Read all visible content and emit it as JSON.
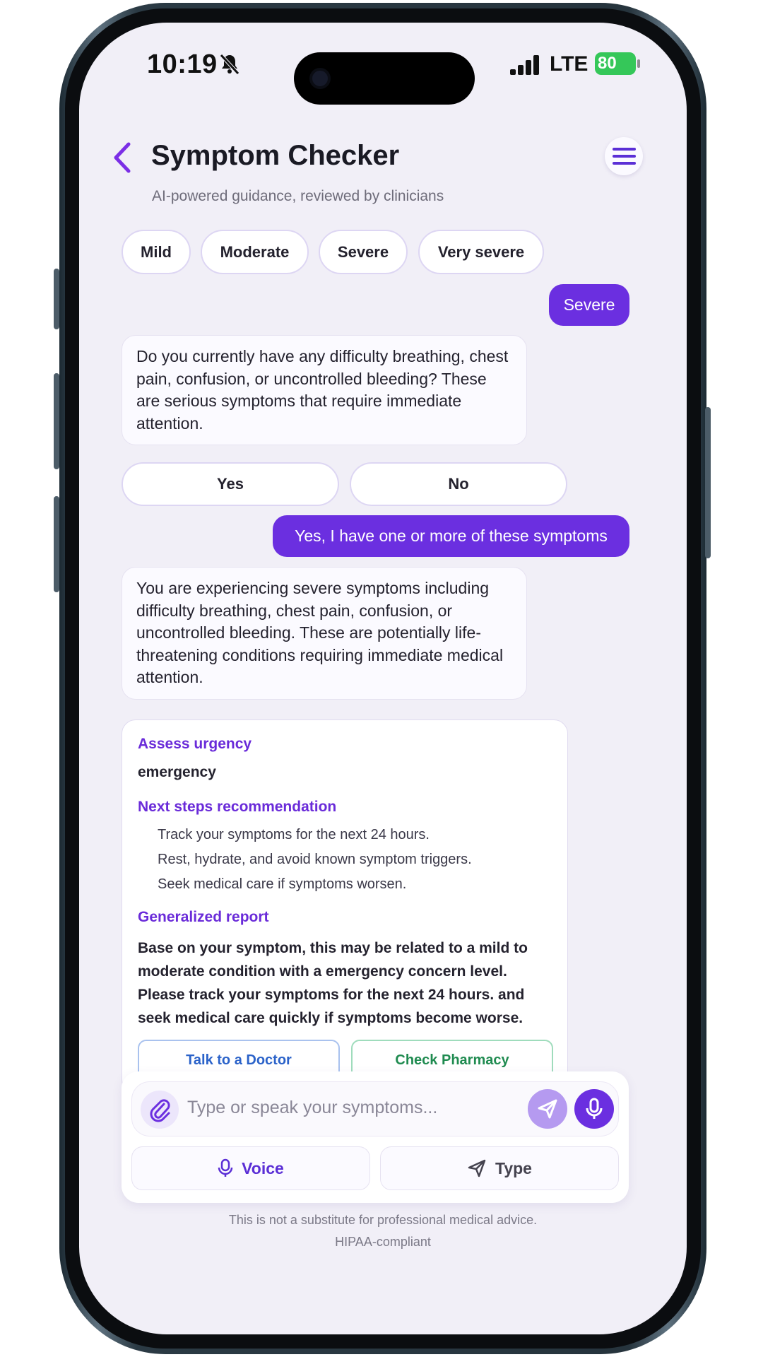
{
  "status": {
    "time": "10:19",
    "network": "LTE",
    "battery": "80"
  },
  "header": {
    "title": "Symptom Checker",
    "subtitle": "AI-powered guidance, reviewed by clinicians"
  },
  "severity_options": [
    "Mild",
    "Moderate",
    "Severe",
    "Very severe"
  ],
  "messages": {
    "user_1": "Severe",
    "bot_1": "Do you currently have any difficulty breathing, chest pain, confusion, or uncontrolled bleeding? These are serious symptoms that require immediate attention.",
    "yes_label": "Yes",
    "no_label": "No",
    "user_2": "Yes, I have one or more of these symptoms",
    "bot_2": "You are experiencing severe symptoms including difficulty breathing, chest pain, confusion, or uncontrolled bleeding. These are potentially life-threatening conditions requiring immediate medical attention."
  },
  "report": {
    "urgency_heading": "Assess urgency",
    "urgency_value": "emergency",
    "steps_heading": "Next steps recommendation",
    "steps": [
      "Track your symptoms for the next 24 hours.",
      "Rest, hydrate, and avoid known symptom triggers.",
      "Seek medical care if symptoms worsen."
    ],
    "report_heading": "Generalized report",
    "report_text": "Base on your symptom, this may be related to a mild to moderate condition with a emergency concern level. Please track your symptoms for the next 24 hours. and seek medical care quickly if symptoms become worse.",
    "doctor_button": "Talk to a Doctor",
    "pharmacy_button": "Check Pharmacy"
  },
  "composer": {
    "placeholder": "Type or speak your symptoms...",
    "voice_label": "Voice",
    "type_label": "Type"
  },
  "footer": {
    "disclaimer": "This is not a substitute for professional medical advice.",
    "compliance": "HIPAA-compliant"
  },
  "colors": {
    "accent": "#6b2fe0",
    "background": "#f1eff7",
    "doctor": "#2a62c9",
    "pharmacy": "#1f8b50"
  },
  "icons": [
    "back-chevron-icon",
    "menu-icon",
    "paperclip-icon",
    "send-icon",
    "microphone-icon",
    "silent-bell-icon"
  ]
}
